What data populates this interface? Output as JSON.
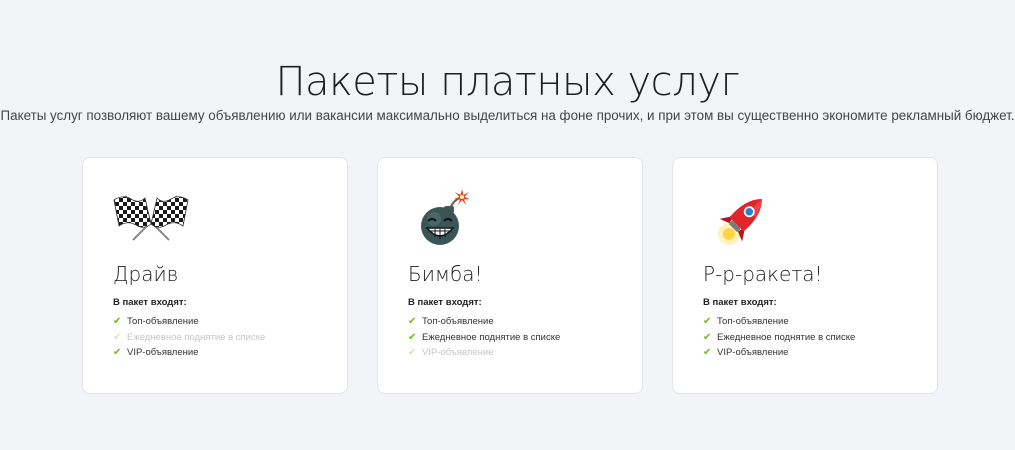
{
  "title": "Пакеты платных услуг",
  "subtitle": "Пакеты услуг позволяют вашему объявлению или вакансии максимально выделиться на фоне прочих, и при этом вы существенно экономите рекламный бюджет.",
  "colors": {
    "accent_check": "#7cb518",
    "background": "#f3f4f8"
  },
  "packages": [
    {
      "name": "Драйв",
      "icon": "checkered-flags-icon",
      "includes_label": "В пакет входят:",
      "features": [
        {
          "label": "Топ-объявление",
          "included": true
        },
        {
          "label": "Ежедневное поднятие в списке",
          "included": false
        },
        {
          "label": "VIP-объявление",
          "included": true
        }
      ]
    },
    {
      "name": "Бимба!",
      "icon": "bomb-icon",
      "includes_label": "В пакет входят:",
      "features": [
        {
          "label": "Топ-объявление",
          "included": true
        },
        {
          "label": "Ежедневное поднятие в списке",
          "included": true
        },
        {
          "label": "VIP-объявление",
          "included": false
        }
      ]
    },
    {
      "name": "Р-р-ракета!",
      "icon": "rocket-icon",
      "includes_label": "В пакет входят:",
      "features": [
        {
          "label": "Топ-объявление",
          "included": true
        },
        {
          "label": "Ежедневное поднятие в списке",
          "included": true
        },
        {
          "label": "VIP-объявление",
          "included": true
        }
      ]
    }
  ]
}
